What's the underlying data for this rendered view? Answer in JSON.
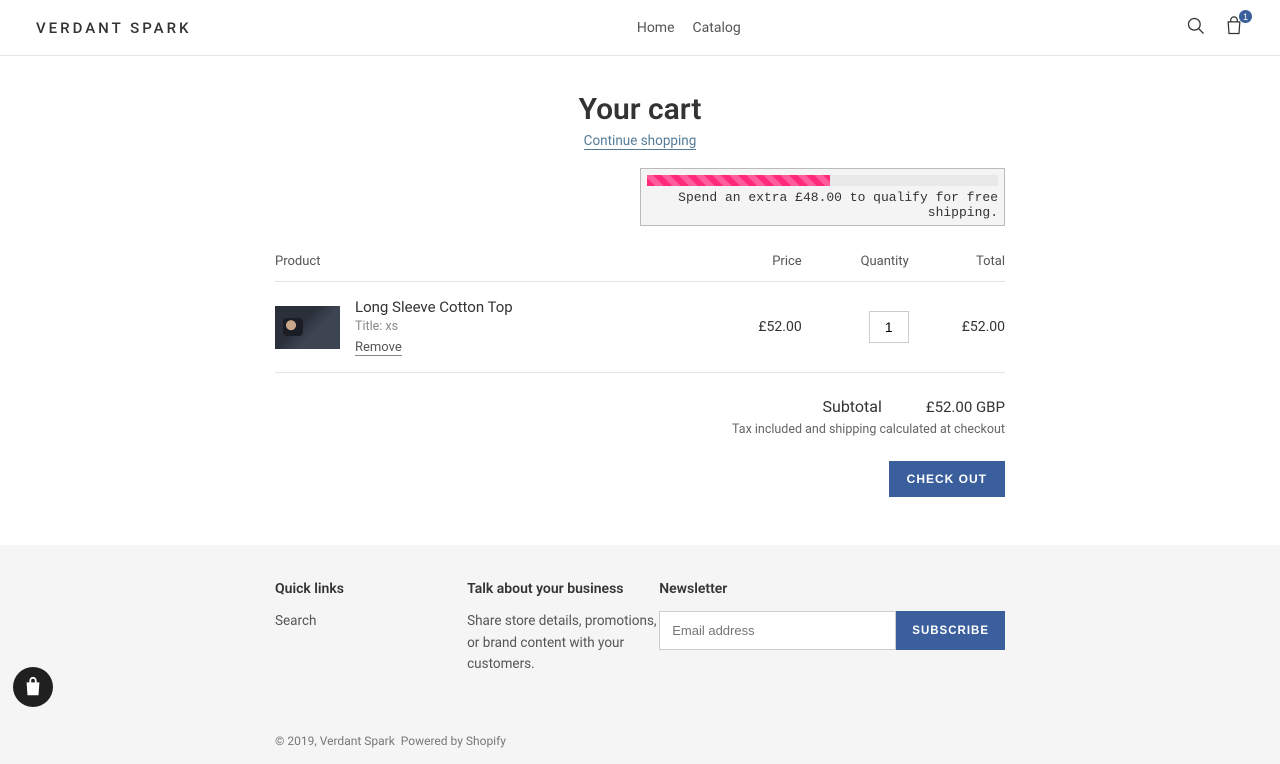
{
  "header": {
    "logo": "VERDANT SPARK",
    "nav": {
      "home": "Home",
      "catalog": "Catalog"
    },
    "cart_count": "1"
  },
  "cart": {
    "title": "Your cart",
    "continue": "Continue shopping",
    "shipping_msg": "Spend an extra £48.00 to qualify for free shipping.",
    "cols": {
      "product": "Product",
      "price": "Price",
      "qty": "Quantity",
      "total": "Total"
    },
    "item": {
      "name": "Long Sleeve Cotton Top",
      "variant": "Title: xs",
      "remove": "Remove",
      "price": "£52.00",
      "qty": "1",
      "total": "£52.00"
    },
    "subtotal_label": "Subtotal",
    "subtotal_value": "£52.00 GBP",
    "tax_note": "Tax included and shipping calculated at checkout",
    "checkout": "Check out"
  },
  "footer": {
    "quick_title": "Quick links",
    "quick_search": "Search",
    "about_title": "Talk about your business",
    "about_text": "Share store details, promotions, or brand content with your customers.",
    "newsletter_title": "Newsletter",
    "email_placeholder": "Email address",
    "subscribe": "Subscribe",
    "copyright_prefix": "© 2019, ",
    "copyright_brand": "Verdant Spark",
    "powered": "Powered by Shopify"
  }
}
